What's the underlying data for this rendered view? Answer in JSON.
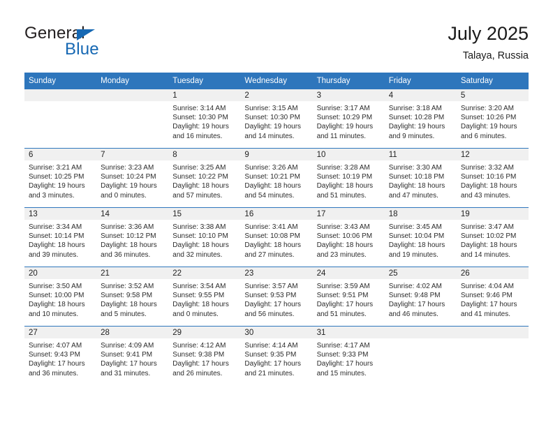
{
  "brand": {
    "name_part1": "General",
    "name_part2": "Blue",
    "logo_icon": "triangle-logo-icon",
    "accent_color": "#1668b3"
  },
  "header": {
    "title": "July 2025",
    "location": "Talaya, Russia"
  },
  "theme": {
    "header_blue": "#2e76bc",
    "band_gray": "#f0f0f0",
    "separator_blue": "#2e76bc"
  },
  "calendar": {
    "weekday_headers": [
      "Sunday",
      "Monday",
      "Tuesday",
      "Wednesday",
      "Thursday",
      "Friday",
      "Saturday"
    ],
    "weeks": [
      [
        {
          "day": "",
          "lines": []
        },
        {
          "day": "",
          "lines": []
        },
        {
          "day": "1",
          "lines": [
            "Sunrise: 3:14 AM",
            "Sunset: 10:30 PM",
            "Daylight: 19 hours",
            "and 16 minutes."
          ]
        },
        {
          "day": "2",
          "lines": [
            "Sunrise: 3:15 AM",
            "Sunset: 10:30 PM",
            "Daylight: 19 hours",
            "and 14 minutes."
          ]
        },
        {
          "day": "3",
          "lines": [
            "Sunrise: 3:17 AM",
            "Sunset: 10:29 PM",
            "Daylight: 19 hours",
            "and 11 minutes."
          ]
        },
        {
          "day": "4",
          "lines": [
            "Sunrise: 3:18 AM",
            "Sunset: 10:28 PM",
            "Daylight: 19 hours",
            "and 9 minutes."
          ]
        },
        {
          "day": "5",
          "lines": [
            "Sunrise: 3:20 AM",
            "Sunset: 10:26 PM",
            "Daylight: 19 hours",
            "and 6 minutes."
          ]
        }
      ],
      [
        {
          "day": "6",
          "lines": [
            "Sunrise: 3:21 AM",
            "Sunset: 10:25 PM",
            "Daylight: 19 hours",
            "and 3 minutes."
          ]
        },
        {
          "day": "7",
          "lines": [
            "Sunrise: 3:23 AM",
            "Sunset: 10:24 PM",
            "Daylight: 19 hours",
            "and 0 minutes."
          ]
        },
        {
          "day": "8",
          "lines": [
            "Sunrise: 3:25 AM",
            "Sunset: 10:22 PM",
            "Daylight: 18 hours",
            "and 57 minutes."
          ]
        },
        {
          "day": "9",
          "lines": [
            "Sunrise: 3:26 AM",
            "Sunset: 10:21 PM",
            "Daylight: 18 hours",
            "and 54 minutes."
          ]
        },
        {
          "day": "10",
          "lines": [
            "Sunrise: 3:28 AM",
            "Sunset: 10:19 PM",
            "Daylight: 18 hours",
            "and 51 minutes."
          ]
        },
        {
          "day": "11",
          "lines": [
            "Sunrise: 3:30 AM",
            "Sunset: 10:18 PM",
            "Daylight: 18 hours",
            "and 47 minutes."
          ]
        },
        {
          "day": "12",
          "lines": [
            "Sunrise: 3:32 AM",
            "Sunset: 10:16 PM",
            "Daylight: 18 hours",
            "and 43 minutes."
          ]
        }
      ],
      [
        {
          "day": "13",
          "lines": [
            "Sunrise: 3:34 AM",
            "Sunset: 10:14 PM",
            "Daylight: 18 hours",
            "and 39 minutes."
          ]
        },
        {
          "day": "14",
          "lines": [
            "Sunrise: 3:36 AM",
            "Sunset: 10:12 PM",
            "Daylight: 18 hours",
            "and 36 minutes."
          ]
        },
        {
          "day": "15",
          "lines": [
            "Sunrise: 3:38 AM",
            "Sunset: 10:10 PM",
            "Daylight: 18 hours",
            "and 32 minutes."
          ]
        },
        {
          "day": "16",
          "lines": [
            "Sunrise: 3:41 AM",
            "Sunset: 10:08 PM",
            "Daylight: 18 hours",
            "and 27 minutes."
          ]
        },
        {
          "day": "17",
          "lines": [
            "Sunrise: 3:43 AM",
            "Sunset: 10:06 PM",
            "Daylight: 18 hours",
            "and 23 minutes."
          ]
        },
        {
          "day": "18",
          "lines": [
            "Sunrise: 3:45 AM",
            "Sunset: 10:04 PM",
            "Daylight: 18 hours",
            "and 19 minutes."
          ]
        },
        {
          "day": "19",
          "lines": [
            "Sunrise: 3:47 AM",
            "Sunset: 10:02 PM",
            "Daylight: 18 hours",
            "and 14 minutes."
          ]
        }
      ],
      [
        {
          "day": "20",
          "lines": [
            "Sunrise: 3:50 AM",
            "Sunset: 10:00 PM",
            "Daylight: 18 hours",
            "and 10 minutes."
          ]
        },
        {
          "day": "21",
          "lines": [
            "Sunrise: 3:52 AM",
            "Sunset: 9:58 PM",
            "Daylight: 18 hours",
            "and 5 minutes."
          ]
        },
        {
          "day": "22",
          "lines": [
            "Sunrise: 3:54 AM",
            "Sunset: 9:55 PM",
            "Daylight: 18 hours",
            "and 0 minutes."
          ]
        },
        {
          "day": "23",
          "lines": [
            "Sunrise: 3:57 AM",
            "Sunset: 9:53 PM",
            "Daylight: 17 hours",
            "and 56 minutes."
          ]
        },
        {
          "day": "24",
          "lines": [
            "Sunrise: 3:59 AM",
            "Sunset: 9:51 PM",
            "Daylight: 17 hours",
            "and 51 minutes."
          ]
        },
        {
          "day": "25",
          "lines": [
            "Sunrise: 4:02 AM",
            "Sunset: 9:48 PM",
            "Daylight: 17 hours",
            "and 46 minutes."
          ]
        },
        {
          "day": "26",
          "lines": [
            "Sunrise: 4:04 AM",
            "Sunset: 9:46 PM",
            "Daylight: 17 hours",
            "and 41 minutes."
          ]
        }
      ],
      [
        {
          "day": "27",
          "lines": [
            "Sunrise: 4:07 AM",
            "Sunset: 9:43 PM",
            "Daylight: 17 hours",
            "and 36 minutes."
          ]
        },
        {
          "day": "28",
          "lines": [
            "Sunrise: 4:09 AM",
            "Sunset: 9:41 PM",
            "Daylight: 17 hours",
            "and 31 minutes."
          ]
        },
        {
          "day": "29",
          "lines": [
            "Sunrise: 4:12 AM",
            "Sunset: 9:38 PM",
            "Daylight: 17 hours",
            "and 26 minutes."
          ]
        },
        {
          "day": "30",
          "lines": [
            "Sunrise: 4:14 AM",
            "Sunset: 9:35 PM",
            "Daylight: 17 hours",
            "and 21 minutes."
          ]
        },
        {
          "day": "31",
          "lines": [
            "Sunrise: 4:17 AM",
            "Sunset: 9:33 PM",
            "Daylight: 17 hours",
            "and 15 minutes."
          ]
        },
        {
          "day": "",
          "lines": []
        },
        {
          "day": "",
          "lines": []
        }
      ]
    ]
  }
}
